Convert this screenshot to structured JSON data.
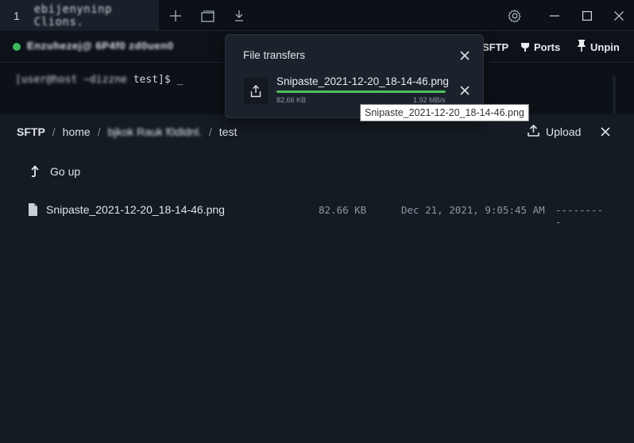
{
  "titlebar": {
    "tab_number": "1",
    "tab_title": "ebijenyninp Clions.",
    "new_tab_icon": "plus-icon",
    "window_icon": "window-icon",
    "download_icon": "download-icon",
    "settings_icon": "gear-icon",
    "minimize_icon": "minimize-icon",
    "maximize_icon": "maximize-icon",
    "close_icon": "close-icon"
  },
  "toolbar": {
    "status_color": "#3cb95a",
    "host": "Enzuhezej@ 6P4f0 zd0uen0",
    "sftp_label": "SFTP",
    "ports_label": "Ports",
    "unpin_label": "Unpin"
  },
  "terminal": {
    "prompt_user": "[user@host ~dizzne",
    "prompt_suffix": " test]$ _"
  },
  "sftp": {
    "breadcrumb": {
      "root": "SFTP",
      "home": "home",
      "user": "bjkok Rauk f0dldnl.",
      "current": "test"
    },
    "upload_label": "Upload",
    "go_up_label": "Go up",
    "files": [
      {
        "name": "Snipaste_2021-12-20_18-14-46.png",
        "size": "82.66 KB",
        "modified": "Dec 21, 2021, 9:05:45 AM",
        "permissions": "---------"
      }
    ]
  },
  "transfers_popup": {
    "title": "File transfers",
    "item": {
      "name": "Snipaste_2021-12-20_18-14-46.png",
      "size": "82.66 KB",
      "speed": "1.92 MB/s",
      "progress_percent": 100
    },
    "progress_color": "#4bc05e"
  },
  "tooltip": {
    "text": "Snipaste_2021-12-20_18-14-46.png"
  }
}
